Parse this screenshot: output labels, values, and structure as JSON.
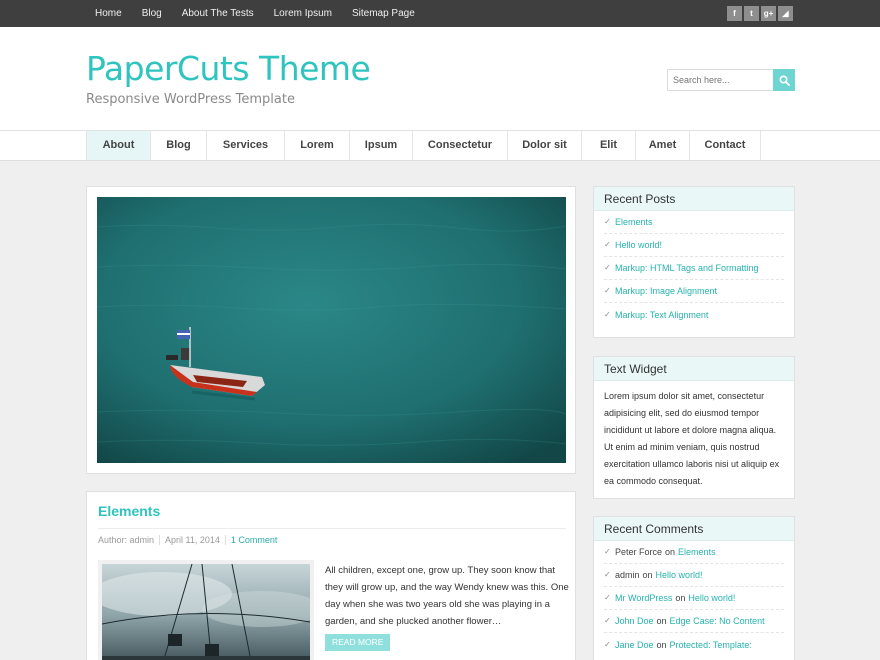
{
  "topnav": [
    "Home",
    "Blog",
    "About The Tests",
    "Lorem Ipsum",
    "Sitemap Page"
  ],
  "social": [
    {
      "icon": "facebook-icon",
      "glyph": "f"
    },
    {
      "icon": "twitter-icon",
      "glyph": "t"
    },
    {
      "icon": "googleplus-icon",
      "glyph": "g+"
    },
    {
      "icon": "rss-icon",
      "glyph": "◢"
    }
  ],
  "site": {
    "title": "PaperCuts Theme",
    "description": "Responsive WordPress Template"
  },
  "search": {
    "placeholder": "Search here..."
  },
  "mainnav": [
    "About",
    "Blog",
    "Services",
    "Lorem",
    "Ipsum",
    "Consectetur",
    "Dolor sit",
    "Elit",
    "Amet",
    "Contact"
  ],
  "post": {
    "title": "Elements",
    "author": "Author: admin",
    "date": "April 11, 2014",
    "comments": "1 Comment",
    "excerpt": "All children, except one, grow up. They soon know that they will grow up, and the way Wendy knew was this. One day when she was two years old she was playing in a garden, and she plucked another flower…",
    "read_more": "READ MORE"
  },
  "widgets": {
    "recent_posts": {
      "title": "Recent Posts",
      "items": [
        "Elements",
        "Hello world!",
        "Markup: HTML Tags and Formatting",
        "Markup: Image Alignment",
        "Markup: Text Alignment"
      ]
    },
    "text_widget": {
      "title": "Text Widget",
      "body": "Lorem ipsum dolor sit amet, consectetur adipisicing elit, sed do eiusmod tempor incididunt ut labore et dolore magna aliqua. Ut enim ad minim veniam, quis nostrud exercitation ullamco laboris nisi ut aliquip ex ea commodo consequat."
    },
    "recent_comments": {
      "title": "Recent Comments",
      "items": [
        {
          "author": "Peter Force",
          "author_link": false,
          "on": "on",
          "post": "Elements"
        },
        {
          "author": "admin",
          "author_link": false,
          "on": "on",
          "post": "Hello world!"
        },
        {
          "author": "Mr WordPress",
          "author_link": true,
          "on": "on",
          "post": "Hello world!"
        },
        {
          "author": "John Doe",
          "author_link": true,
          "on": "on",
          "post": "Edge Case: No Content"
        },
        {
          "author": "Jane Doe",
          "author_link": true,
          "on": "on",
          "post": "Protected: Template:"
        }
      ]
    }
  },
  "colors": {
    "accent": "#2fc4bf",
    "topbar": "#3f3f3f",
    "widget_header": "#e9f7f7"
  }
}
